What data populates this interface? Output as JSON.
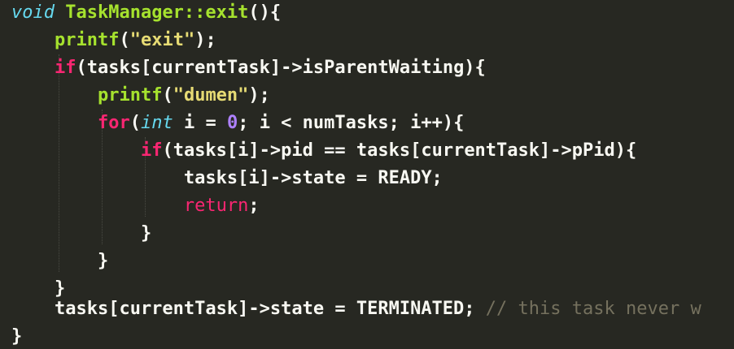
{
  "editor": {
    "colors": {
      "background": "#272822",
      "text": "#f8f8f2",
      "keyword": "#f92672",
      "type": "#66d9ef",
      "function": "#a6e22e",
      "string": "#e6db74",
      "number": "#ae81ff",
      "comment": "#75715e"
    },
    "lines": [
      {
        "t": [
          {
            "k": "typ",
            "v": "void"
          },
          {
            "k": "fn",
            "v": " TaskManager::exit"
          },
          {
            "k": "txt",
            "v": "(){"
          }
        ]
      },
      {
        "t": [
          {
            "k": "txt",
            "v": "    "
          },
          {
            "k": "fn",
            "v": "printf"
          },
          {
            "k": "txt",
            "v": "("
          },
          {
            "k": "str",
            "v": "\"exit\""
          },
          {
            "k": "txt",
            "v": ");"
          }
        ]
      },
      {
        "t": [
          {
            "k": "txt",
            "v": "    "
          },
          {
            "k": "kw",
            "v": "if"
          },
          {
            "k": "txt",
            "v": "(tasks[currentTask]->isParentWaiting){"
          }
        ]
      },
      {
        "t": [
          {
            "k": "txt",
            "v": "        "
          },
          {
            "k": "fn",
            "v": "printf"
          },
          {
            "k": "txt",
            "v": "("
          },
          {
            "k": "str",
            "v": "\"dumen\""
          },
          {
            "k": "txt",
            "v": ");"
          }
        ]
      },
      {
        "t": [
          {
            "k": "txt",
            "v": "        "
          },
          {
            "k": "kw",
            "v": "for"
          },
          {
            "k": "txt",
            "v": "("
          },
          {
            "k": "typ",
            "v": "int"
          },
          {
            "k": "txt",
            "v": " i = "
          },
          {
            "k": "num",
            "v": "0"
          },
          {
            "k": "txt",
            "v": "; i < numTasks; i++){"
          }
        ]
      },
      {
        "t": [
          {
            "k": "txt",
            "v": "            "
          },
          {
            "k": "kw",
            "v": "if"
          },
          {
            "k": "txt",
            "v": "(tasks[i]->pid == tasks[currentTask]->pPid){"
          }
        ]
      },
      {
        "t": [
          {
            "k": "txt",
            "v": "                tasks[i]->state = READY;"
          }
        ]
      },
      {
        "t": [
          {
            "k": "txt",
            "v": "                "
          },
          {
            "k": "rt",
            "v": "return"
          },
          {
            "k": "txt",
            "v": ";"
          }
        ]
      },
      {
        "t": [
          {
            "k": "txt",
            "v": "            }"
          }
        ]
      },
      {
        "t": [
          {
            "k": "txt",
            "v": "        }"
          }
        ]
      },
      {
        "t": [
          {
            "k": "txt",
            "v": "    }"
          }
        ]
      },
      {
        "t": []
      },
      {
        "t": [
          {
            "k": "txt",
            "v": "    tasks[currentTask]->state = TERMINATED; "
          },
          {
            "k": "cmt",
            "v": "// this task never w"
          }
        ]
      },
      {
        "t": [
          {
            "k": "txt",
            "v": "}"
          }
        ]
      }
    ]
  }
}
